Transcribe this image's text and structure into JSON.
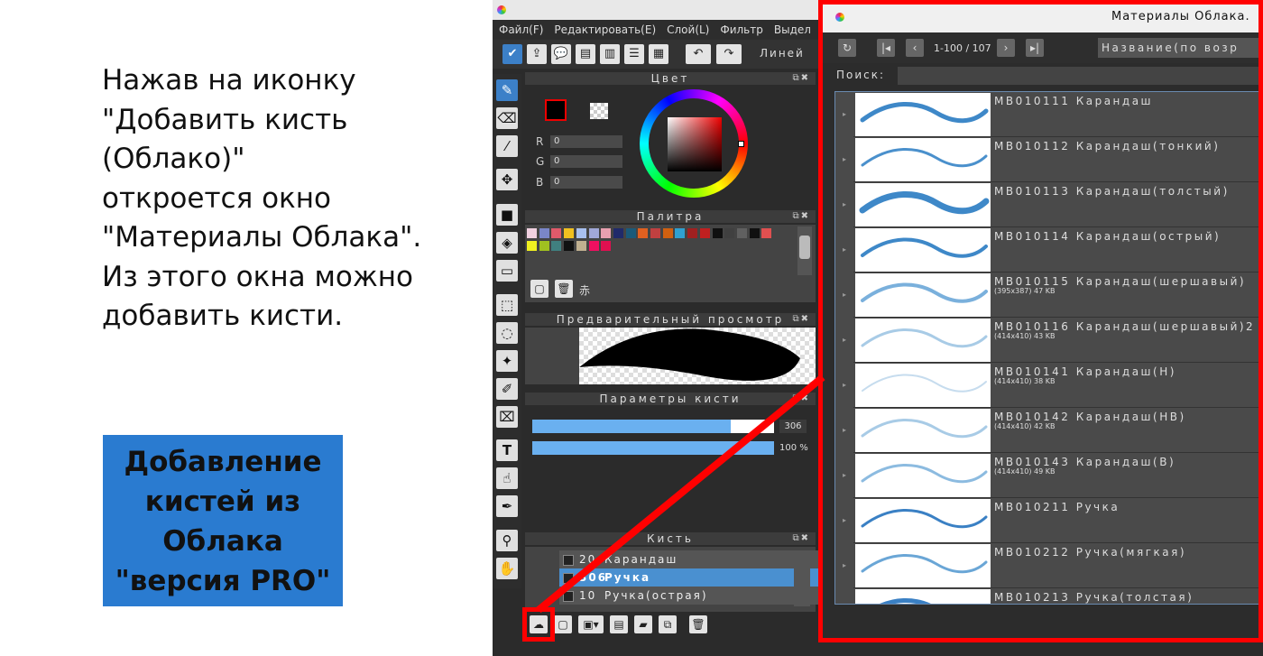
{
  "explanation": "Нажав на иконку\n\"Добавить кисть (Облако)\"\nоткроется окно\n\"Материалы Облака\".\nИз этого окна можно\nдобавить кисти.",
  "promo_text": "Добавление\nкистей из\nОблака\n\"версия PRO\"",
  "menu": [
    "Файл(F)",
    "Редактировать(E)",
    "Слой(L)",
    "Фильтр",
    "Выдел"
  ],
  "toolbar_line_label": "Линей",
  "panels": {
    "color": {
      "title": "Цвет",
      "r_label": "R",
      "g_label": "G",
      "b_label": "B",
      "r": "0",
      "g": "0",
      "b": "0"
    },
    "palette": {
      "title": "Палитра",
      "selected_label": "赤",
      "row1": [
        "#f0d0e0",
        "#7a86c8",
        "#e05a6a",
        "#f0c020",
        "#a8c0f0",
        "#a0a8d8",
        "#e8a0b0",
        "#202a6a",
        "#1a5a7a",
        "#e06020",
        "#c04040",
        "#d06010",
        "#30a0d0",
        "#a02020",
        "#c02020",
        "#101010",
        "#404040",
        "#606060",
        "#101010",
        "#e05050"
      ],
      "row2": [
        "#f0f020",
        "#a0c020",
        "#408080",
        "#101010",
        "#c0b090",
        "#f01060",
        "#e01050"
      ]
    },
    "preview": {
      "title": "Предварительный просмотр"
    },
    "brush_params": {
      "title": "Параметры кисти",
      "size": "306",
      "opacity": "100 %",
      "size_fraction": 0.82,
      "opacity_fraction": 1.0
    },
    "brush": {
      "title": "Кисть",
      "items": [
        {
          "size": "20",
          "name": "Карандаш"
        },
        {
          "size": "306",
          "name": "Ручка"
        },
        {
          "size": "10",
          "name": "Ручка(острая)"
        }
      ]
    }
  },
  "cloud": {
    "title": "Материалы Облака.",
    "pagination": "1-100 / 107",
    "sort": "Название(по возр",
    "search_label": "Поиск:",
    "search_value": "",
    "items": [
      {
        "name": "MB010111 Карандаш",
        "size": ""
      },
      {
        "name": "MB010112 Карандаш(тонкий)",
        "size": ""
      },
      {
        "name": "MB010113 Карандаш(толстый)",
        "size": ""
      },
      {
        "name": "MB010114 Карандаш(острый)",
        "size": ""
      },
      {
        "name": "MB010115 Карандаш(шершавый)",
        "size": "(395x387) 47 KB"
      },
      {
        "name": "MB010116 Карандаш(шершавый)2",
        "size": "(414x410) 43 KB"
      },
      {
        "name": "MB010141 Карандаш(H)",
        "size": "(414x410) 38 KB"
      },
      {
        "name": "MB010142 Карандаш(HB)",
        "size": "(414x410) 42 KB"
      },
      {
        "name": "MB010143 Карандаш(B)",
        "size": "(414x410) 49 KB"
      },
      {
        "name": "MB010211 Ручка",
        "size": ""
      },
      {
        "name": "MB010212 Ручка(мягкая)",
        "size": ""
      },
      {
        "name": "MB010213 Ручка(толстая)",
        "size": ""
      }
    ]
  },
  "colors": {
    "accent_red": "#ff0000",
    "promo_blue": "#2a7bd0",
    "selection_blue": "#4a90d0"
  }
}
